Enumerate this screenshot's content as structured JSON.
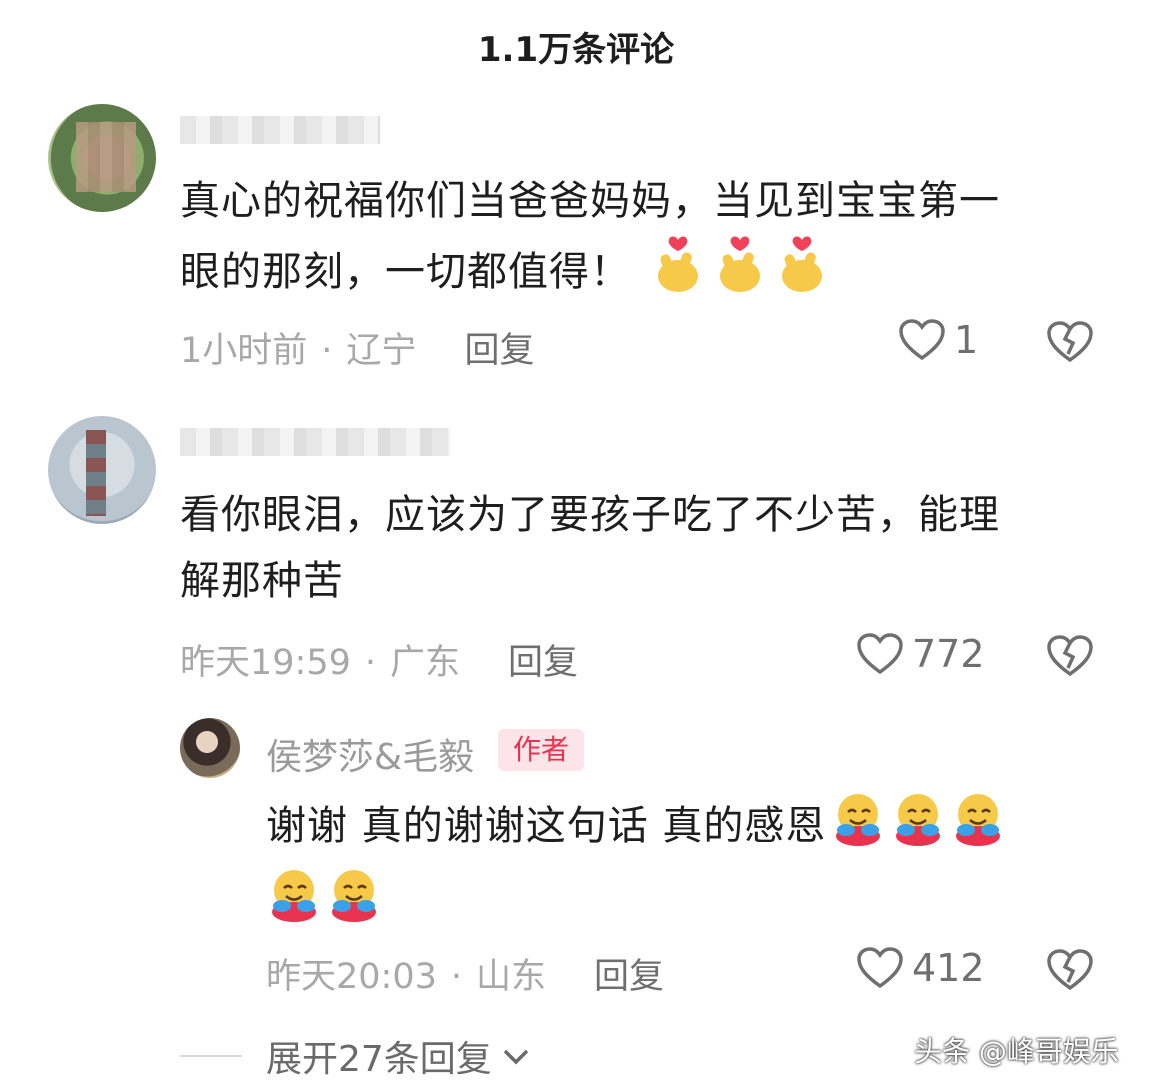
{
  "header": {
    "title": "1.1万条评论"
  },
  "comments": [
    {
      "text_line1": "真心的祝福你们当爸爸妈妈，当见到宝宝第一",
      "text_line2": "眼的那刻，一切都值得！",
      "time": "1小时前",
      "location": "辽宁",
      "reply_label": "回复",
      "likes": "1"
    },
    {
      "text_line1": "看你眼泪，应该为了要孩子吃了不少苦，能理",
      "text_line2": "解那种苦",
      "time": "昨天19:59",
      "location": "广东",
      "reply_label": "回复",
      "likes": "772"
    }
  ],
  "author_reply": {
    "name": "侯梦莎&毛毅",
    "badge": "作者",
    "text": "谢谢 真的谢谢这句话 真的感恩",
    "time": "昨天20:03",
    "location": "山东",
    "reply_label": "回复",
    "likes": "412"
  },
  "expand": {
    "label": "展开27条回复"
  },
  "watermark": {
    "text": "头条 @峰哥娱乐"
  },
  "meta_separator": "·",
  "colors": {
    "badge_text": "#e8334f",
    "badge_bg": "#fde4e8",
    "meta": "#a8a8a8"
  },
  "icons": [
    "heart-outline-icon",
    "broken-heart-icon",
    "finger-heart-emoji",
    "hugging-face-emoji",
    "chevron-down-icon"
  ]
}
